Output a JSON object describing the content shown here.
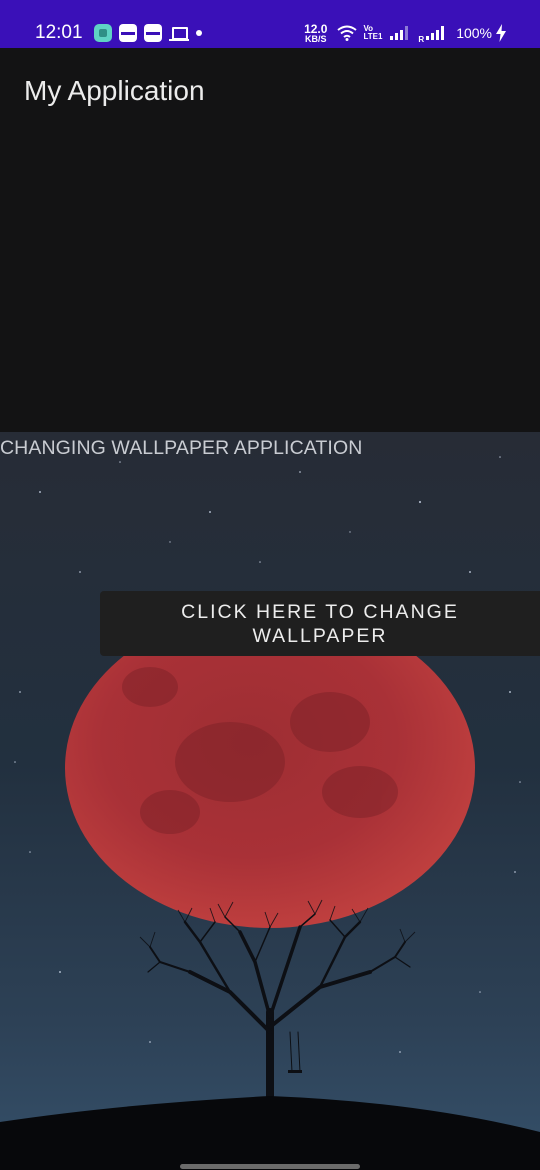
{
  "status_bar": {
    "time": "12:01",
    "net_speed_value": "12.0",
    "net_speed_unit": "KB/S",
    "volte_top": "Vo",
    "volte_bottom": "LTE1",
    "roaming": "R",
    "battery": "100%",
    "notification_icons": [
      "app-icon",
      "card-icon",
      "card-icon",
      "laptop-icon",
      "more-dot"
    ],
    "background_color": "#3a10b8"
  },
  "app_bar": {
    "title": "My Application"
  },
  "main": {
    "caption": "CHANGING WALLPAPER APPLICATION",
    "change_button_label": "CLICK HERE TO CHANGE WALLPAPER"
  },
  "wallpaper_image": {
    "subject": "red-moon-tree-swing-night-sky",
    "moon_color": "#b8343a",
    "sky_color": "#1c2736"
  }
}
